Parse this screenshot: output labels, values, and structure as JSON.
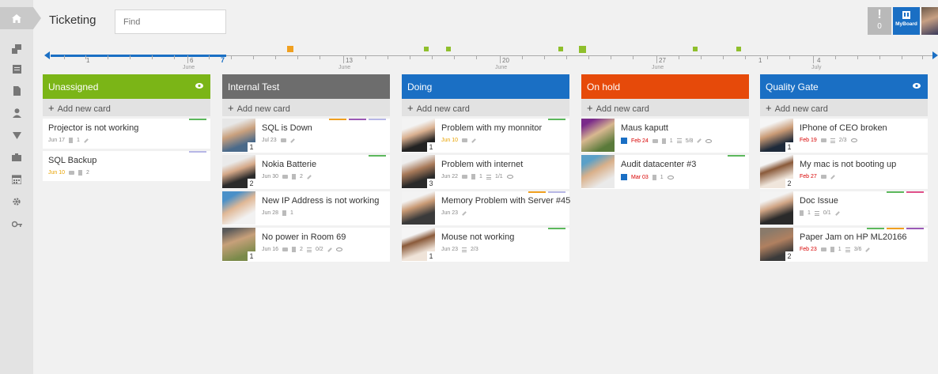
{
  "app": {
    "title": "Ticketing"
  },
  "search": {
    "placeholder": "Find"
  },
  "header": {
    "alert_count": "0",
    "myboard_label": "MyBoard"
  },
  "timeline": {
    "days": [
      {
        "num": "1",
        "month": ""
      },
      {
        "num": "6",
        "month": "June"
      },
      {
        "num": "7",
        "month": ""
      },
      {
        "num": "13",
        "month": "June"
      },
      {
        "num": "20",
        "month": "June"
      },
      {
        "num": "27",
        "month": "June"
      },
      {
        "num": "1",
        "month": ""
      },
      {
        "num": "4",
        "month": "July"
      }
    ]
  },
  "colors": {
    "unassigned": "#7bb517",
    "internal_test": "#6d6d6d",
    "doing": "#1a6fc4",
    "on_hold": "#e64a0a",
    "quality_gate": "#1a6fc4",
    "bar_green": "#5cb85c",
    "bar_orange": "#f0a020",
    "bar_purple": "#9b59b6",
    "bar_lavender": "#b7b7e6",
    "bar_pink": "#e0508a"
  },
  "columns": [
    {
      "title": "Unassigned",
      "add_label": "Add new card",
      "cards": [
        {
          "title": "Projector is not working",
          "date": "Jun 17",
          "docs": "1"
        },
        {
          "title": "SQL Backup",
          "date": "Jun 10",
          "docs": "2"
        }
      ]
    },
    {
      "title": "Internal Test",
      "add_label": "Add new card",
      "cards": [
        {
          "title": "SQL is Down",
          "date": "Jul 23",
          "count": "1"
        },
        {
          "title": "Nokia Batterie",
          "date": "Jun 30",
          "docs": "2",
          "count": "2"
        },
        {
          "title": "New IP Address is not working",
          "date": "Jun 28",
          "docs": "1"
        },
        {
          "title": "No power in Room 69",
          "date": "Jun 16",
          "docs": "2",
          "tasks": "0/2",
          "count": "1"
        }
      ]
    },
    {
      "title": "Doing",
      "add_label": "Add new card",
      "cards": [
        {
          "title": "Problem with my monnitor",
          "date": "Jun 10",
          "count": "1"
        },
        {
          "title": "Problem with internet",
          "date": "Jun 22",
          "docs": "1",
          "tasks": "1/1",
          "count": "3"
        },
        {
          "title": "Memory Problem with Server #45",
          "date": "Jun 23"
        },
        {
          "title": "Mouse not working",
          "date": "Jun 23",
          "tasks": "2/3",
          "count": "1"
        }
      ]
    },
    {
      "title": "On hold",
      "add_label": "Add new card",
      "cards": [
        {
          "title": "Maus kaputt",
          "date": "Feb 24",
          "docs": "1",
          "tasks": "5/8"
        },
        {
          "title": "Audit datacenter #3",
          "date": "Mar 03",
          "docs": "1"
        }
      ]
    },
    {
      "title": "Quality Gate",
      "add_label": "Add new card",
      "cards": [
        {
          "title": "IPhone of CEO broken",
          "date": "Feb 19",
          "tasks": "2/3",
          "count": "1"
        },
        {
          "title": "My mac is not booting up",
          "date": "Feb 27",
          "count": "2"
        },
        {
          "title": "Doc Issue",
          "docs": "1",
          "tasks": "0/1"
        },
        {
          "title": "Paper Jam on HP ML20166",
          "date": "Feb 23",
          "docs": "1",
          "tasks": "3/6",
          "count": "2"
        }
      ]
    }
  ]
}
